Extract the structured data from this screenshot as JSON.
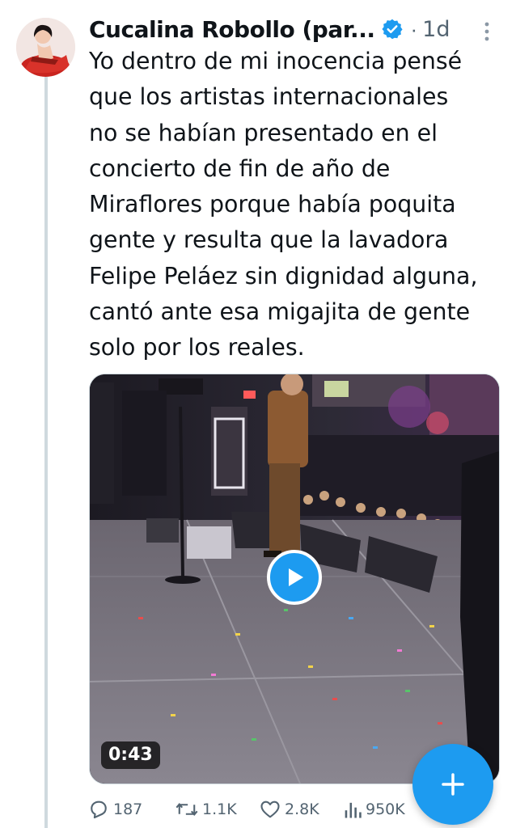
{
  "tweet": {
    "author": {
      "display_name": "Cucalina Robollo (par...",
      "verified": true,
      "avatar_icon": "avatar-image"
    },
    "separator": "·",
    "time": "1d",
    "text_lines": [
      "Yo dentro de mi inocencia pensé",
      "que los artistas internacionales",
      "no se habían presentado en el",
      "concierto de fin de año de",
      "Miraflores porque había poquita",
      "gente y resulta que la lavadora",
      "Felipe Peláez sin dignidad alguna,",
      "cantó ante esa migajita de gente",
      "solo por los reales."
    ],
    "media": {
      "type": "video",
      "duration": "0:43",
      "play_icon": "play-icon"
    },
    "actions": {
      "replies": "187",
      "reposts": "1.1K",
      "likes": "2.8K",
      "views": "950K"
    }
  },
  "fab": {
    "icon": "plus-icon"
  },
  "colors": {
    "accent": "#1d9bf0",
    "text": "#0f1419",
    "secondary": "#536471",
    "thread_line": "#cfd9de"
  }
}
